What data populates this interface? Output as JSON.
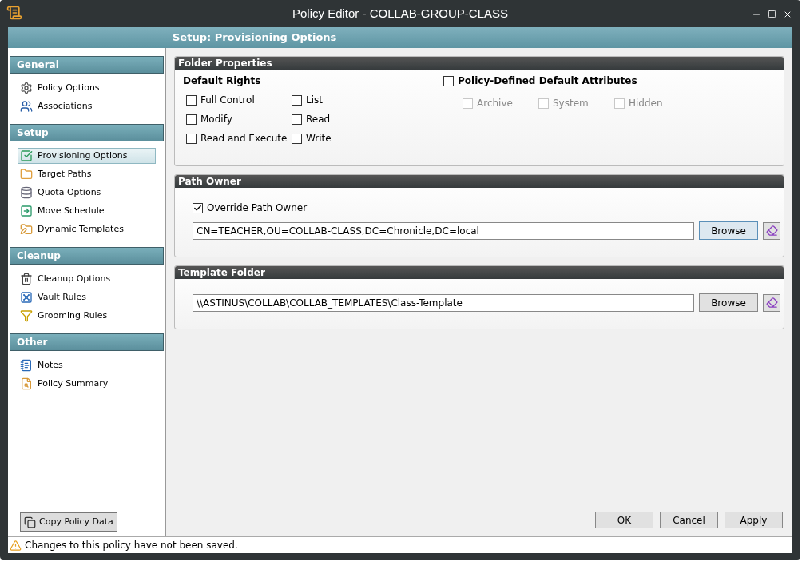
{
  "window": {
    "title": "Policy Editor - COLLAB-GROUP-CLASS"
  },
  "header": "Setup: Provisioning Options",
  "sidebar": [
    {
      "title": "General",
      "items": [
        {
          "label": "Policy Options",
          "selected": false
        },
        {
          "label": "Associations",
          "selected": false
        }
      ]
    },
    {
      "title": "Setup",
      "items": [
        {
          "label": "Provisioning Options",
          "selected": true
        },
        {
          "label": "Target Paths",
          "selected": false
        },
        {
          "label": "Quota Options",
          "selected": false
        },
        {
          "label": "Move Schedule",
          "selected": false
        },
        {
          "label": "Dynamic Templates",
          "selected": false
        }
      ]
    },
    {
      "title": "Cleanup",
      "items": [
        {
          "label": "Cleanup Options",
          "selected": false
        },
        {
          "label": "Vault Rules",
          "selected": false
        },
        {
          "label": "Grooming Rules",
          "selected": false
        }
      ]
    },
    {
      "title": "Other",
      "items": [
        {
          "label": "Notes",
          "selected": false
        },
        {
          "label": "Policy Summary",
          "selected": false
        }
      ]
    }
  ],
  "copy_button": "Copy Policy Data",
  "folder_properties": {
    "title": "Folder Properties",
    "rights_title": "Default Rights",
    "rights": [
      {
        "label": "Full Control",
        "checked": false
      },
      {
        "label": "List",
        "checked": false
      },
      {
        "label": "Modify",
        "checked": false
      },
      {
        "label": "Read",
        "checked": false
      },
      {
        "label": "Read and Execute",
        "checked": false
      },
      {
        "label": "Write",
        "checked": false
      }
    ],
    "attributes_toggle": {
      "label": "Policy-Defined Default Attributes",
      "checked": false
    },
    "attributes": [
      {
        "label": "Archive",
        "checked": false,
        "disabled": true
      },
      {
        "label": "System",
        "checked": false,
        "disabled": true
      },
      {
        "label": "Hidden",
        "checked": false,
        "disabled": true
      }
    ]
  },
  "path_owner": {
    "title": "Path Owner",
    "override": {
      "label": "Override Path Owner",
      "checked": true
    },
    "value": "CN=TEACHER,OU=COLLAB-CLASS,DC=Chronicle,DC=local",
    "browse": "Browse"
  },
  "template_folder": {
    "title": "Template Folder",
    "value": "\\\\ASTINUS\\COLLAB\\COLLAB_TEMPLATES\\Class-Template",
    "browse": "Browse"
  },
  "buttons": [
    "OK",
    "Cancel",
    "Apply"
  ],
  "status_bar": "Changes to this policy have not been saved."
}
